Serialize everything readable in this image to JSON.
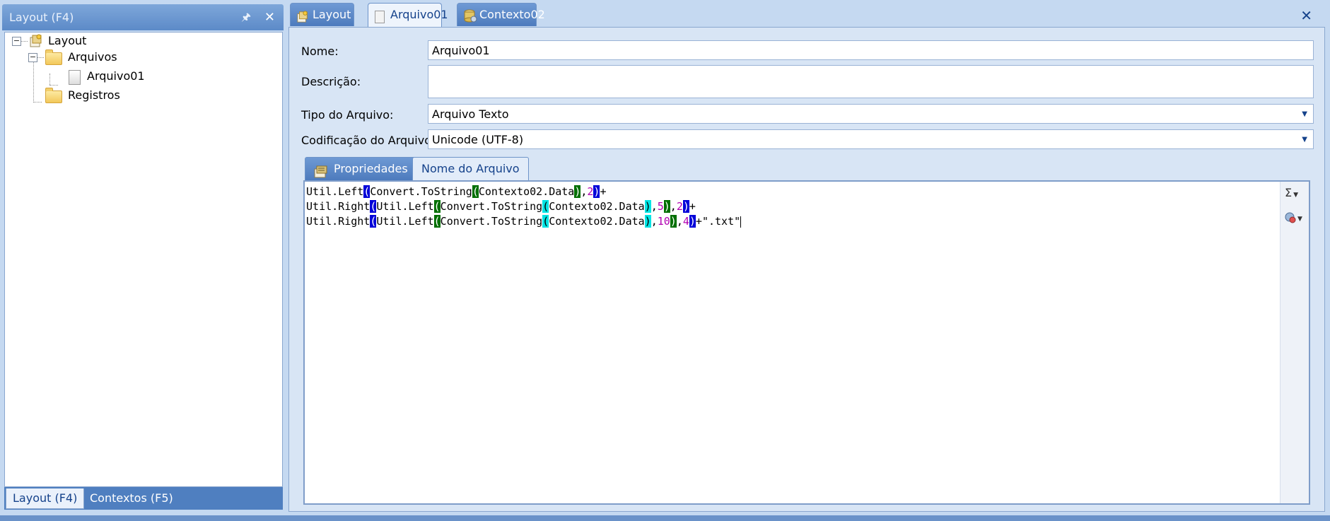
{
  "left_panel": {
    "title": "Layout (F4)",
    "pin_icon": "pin-icon",
    "close_icon": "close-icon",
    "tree": [
      {
        "label": "Layout",
        "icon": "layout-icon"
      },
      {
        "label": "Arquivos",
        "icon": "folder-icon"
      },
      {
        "label": "Arquivo01",
        "icon": "document-icon"
      },
      {
        "label": "Registros",
        "icon": "folder-icon"
      }
    ],
    "bottom_tabs": [
      "Layout (F4)",
      "Contextos (F5)"
    ]
  },
  "doc_tabs": [
    {
      "label": "Layout",
      "icon": "layout-icon"
    },
    {
      "label": "Arquivo01",
      "icon": "document-icon"
    },
    {
      "label": "Contexto02",
      "icon": "database-icon"
    }
  ],
  "form": {
    "nome_label": "Nome:",
    "nome_value": "Arquivo01",
    "descricao_label": "Descrição:",
    "descricao_value": "",
    "tipo_label": "Tipo do Arquivo:",
    "tipo_value": "Arquivo Texto",
    "codificacao_label": "Codificação do Arquivo:",
    "codificacao_value": "Unicode (UTF-8)"
  },
  "sub_tabs": [
    "Propriedades",
    "Nome do Arquivo"
  ],
  "editor": {
    "lines": [
      "Util.Left(Convert.ToString(Contexto02.Data),2)+",
      "Util.Right(Util.Left(Convert.ToString(Contexto02.Data),5),2)+",
      "Util.Right(Util.Left(Convert.ToString(Contexto02.Data),10),4)+\".txt\""
    ],
    "sigma_icon": "sigma-icon",
    "context_icon": "context-icon"
  },
  "colors": {
    "bracket_blue": "#0000d8",
    "bracket_green": "#006f00",
    "bracket_cyan": "#00e4e4",
    "number": "#b000b0"
  }
}
